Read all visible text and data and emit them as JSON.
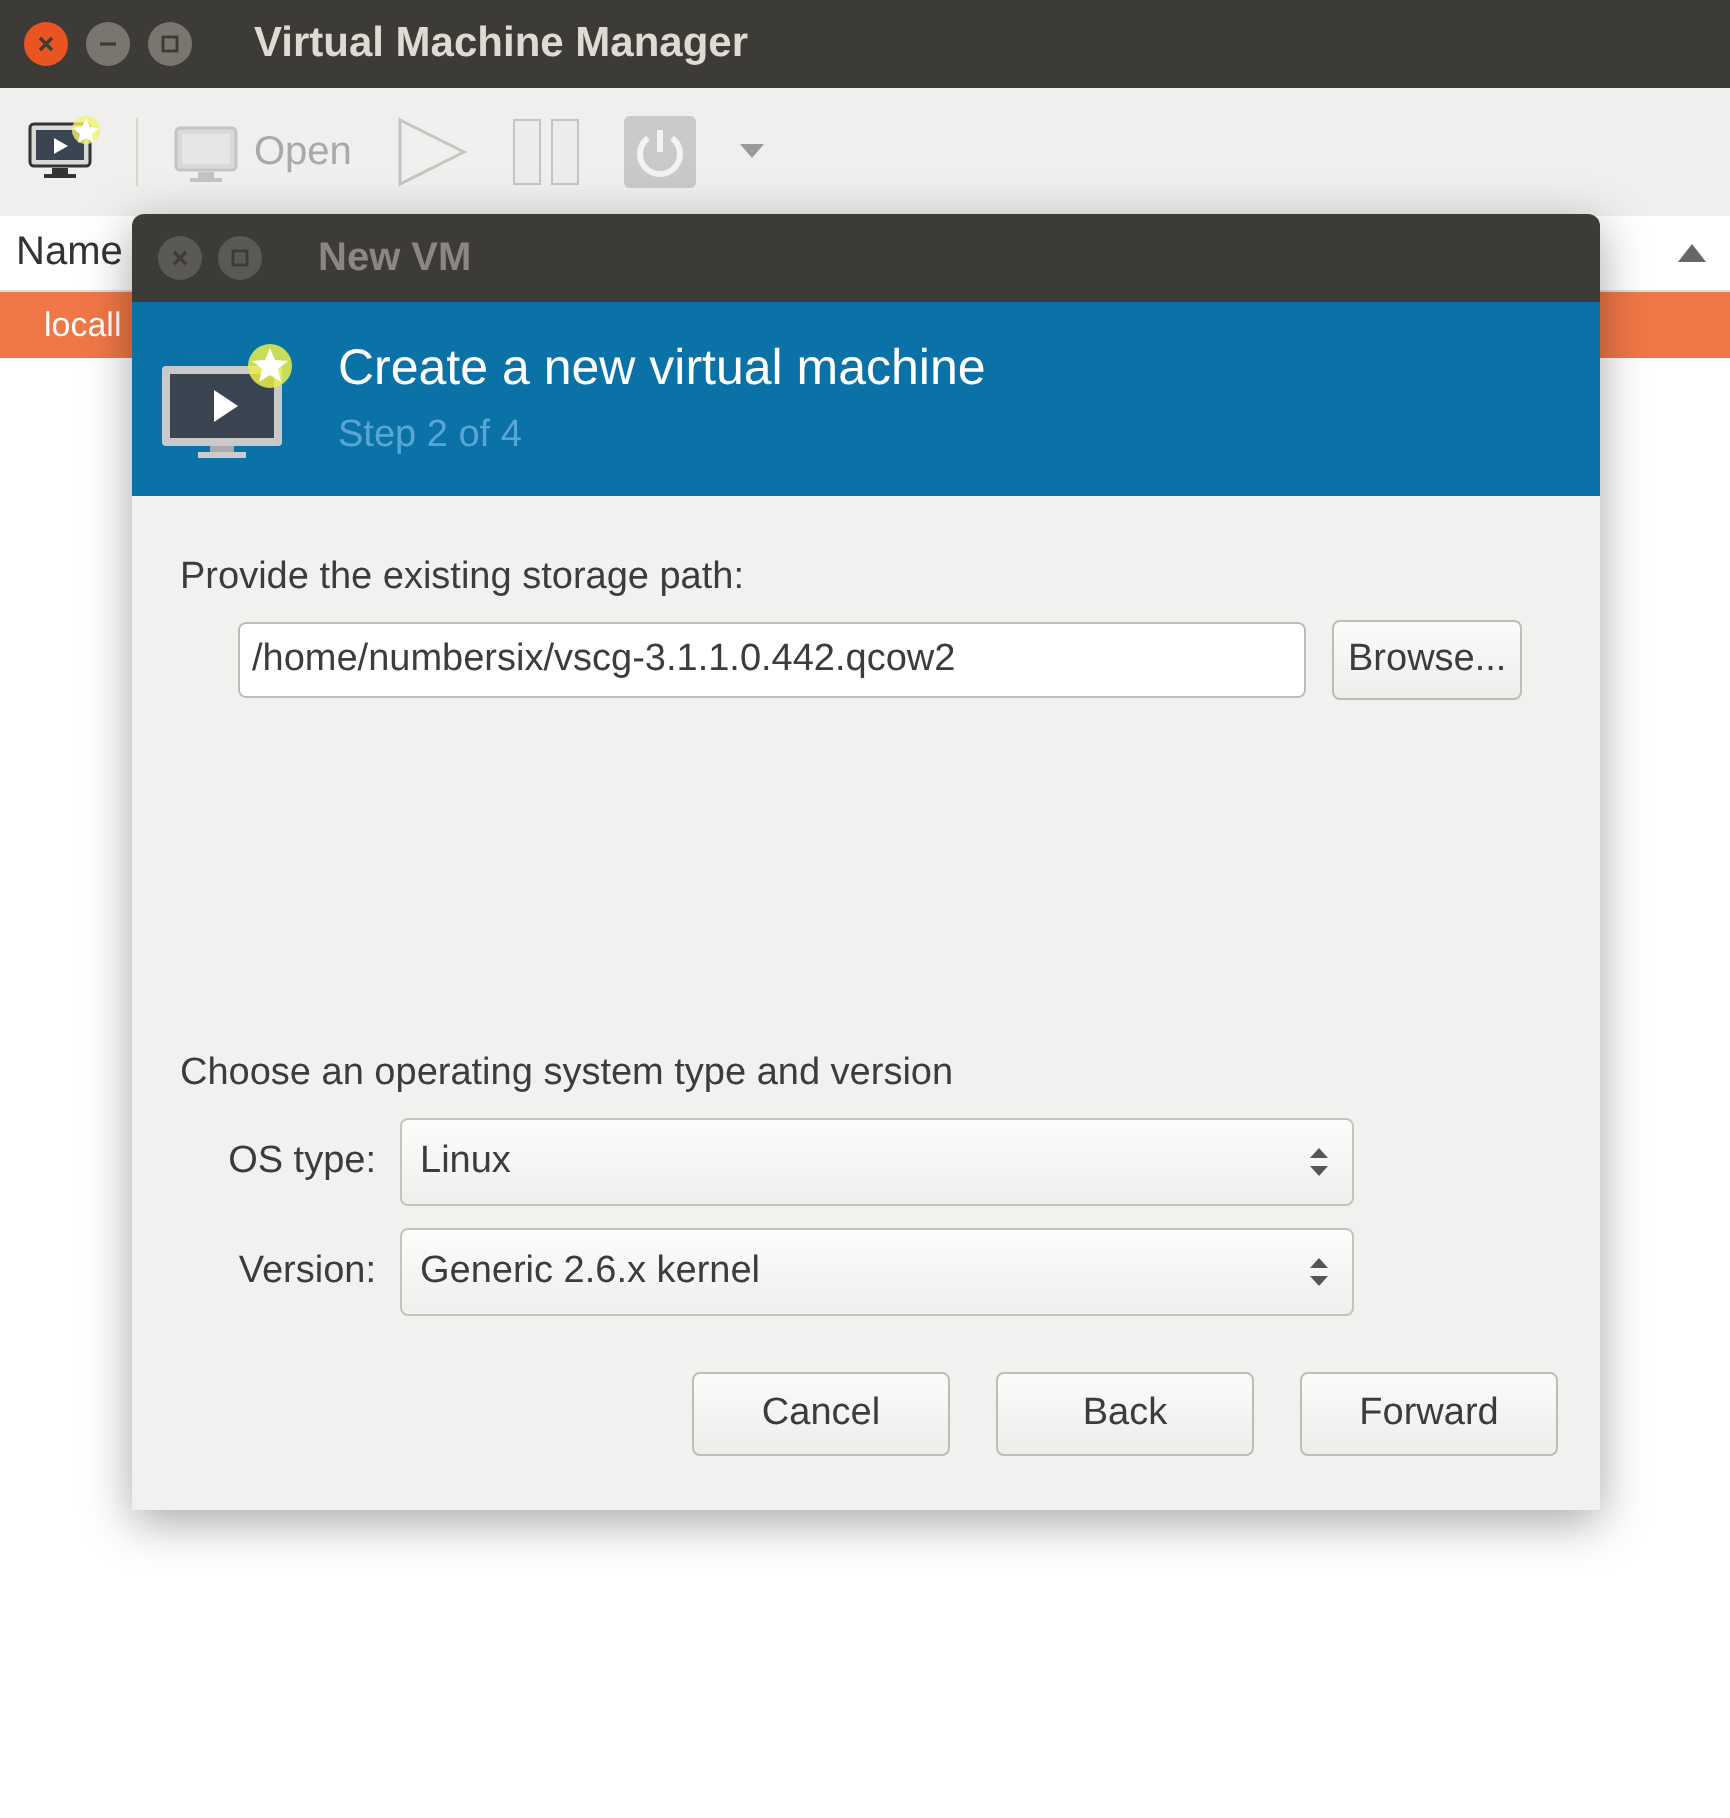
{
  "window": {
    "title": "Virtual Machine Manager"
  },
  "toolbar": [
    {
      "kind": "new",
      "disabled": false
    },
    {
      "kind": "open",
      "label": "Open",
      "disabled": true
    },
    {
      "kind": "run",
      "disabled": true
    },
    {
      "kind": "pause",
      "disabled": true
    },
    {
      "kind": "shutdown",
      "disabled": true
    },
    {
      "kind": "menu",
      "disabled": true
    }
  ],
  "table": {
    "columns": [
      {
        "label": "Name"
      }
    ],
    "rows": [
      {
        "name": "locall",
        "selected": true
      }
    ]
  },
  "dialog": {
    "title": "New VM",
    "heading": "Create a new virtual machine",
    "step": "Step 2 of 4",
    "storage_label": "Provide the existing storage path:",
    "storage_path": "/home/numbersix/vscg-3.1.1.0.442.qcow2",
    "browse_button": "Browse...",
    "os_label": "Choose an operating system type and version",
    "fields": [
      {
        "label": "OS type:",
        "value": "Linux"
      },
      {
        "label": "Version:",
        "value": "Generic 2.6.x kernel"
      }
    ],
    "buttons": [
      "Cancel",
      "Back",
      "Forward"
    ]
  }
}
